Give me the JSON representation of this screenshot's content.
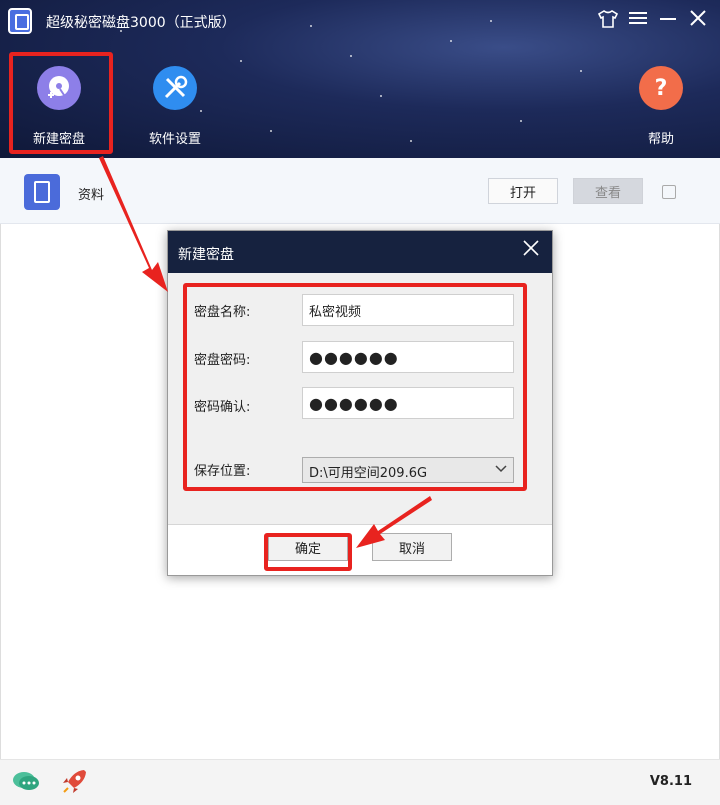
{
  "app": {
    "title": "超级秘密磁盘3000（正式版）"
  },
  "toolbar": {
    "new_disk": "新建密盘",
    "settings": "软件设置",
    "help": "帮助"
  },
  "window_controls": {
    "skin": "skin-icon",
    "menu": "menu-icon",
    "minimize": "minimize-icon",
    "close": "close-icon"
  },
  "disk_list": {
    "items": [
      {
        "name": "资料",
        "open_label": "打开",
        "view_label": "查看"
      }
    ]
  },
  "dialog": {
    "title": "新建密盘",
    "name_label": "密盘名称:",
    "name_value": "私密视频",
    "password_label": "密盘密码:",
    "password_value": "●●●●●●",
    "confirm_label": "密码确认:",
    "confirm_value": "●●●●●●",
    "location_label": "保存位置:",
    "location_value": "D:\\可用空间209.6G",
    "ok_label": "确定",
    "cancel_label": "取消"
  },
  "footer": {
    "version": "V8.11"
  },
  "colors": {
    "highlight": "#e8231f",
    "header_bg": "#1d2a5a",
    "dialog_title_bg": "#16223f"
  }
}
